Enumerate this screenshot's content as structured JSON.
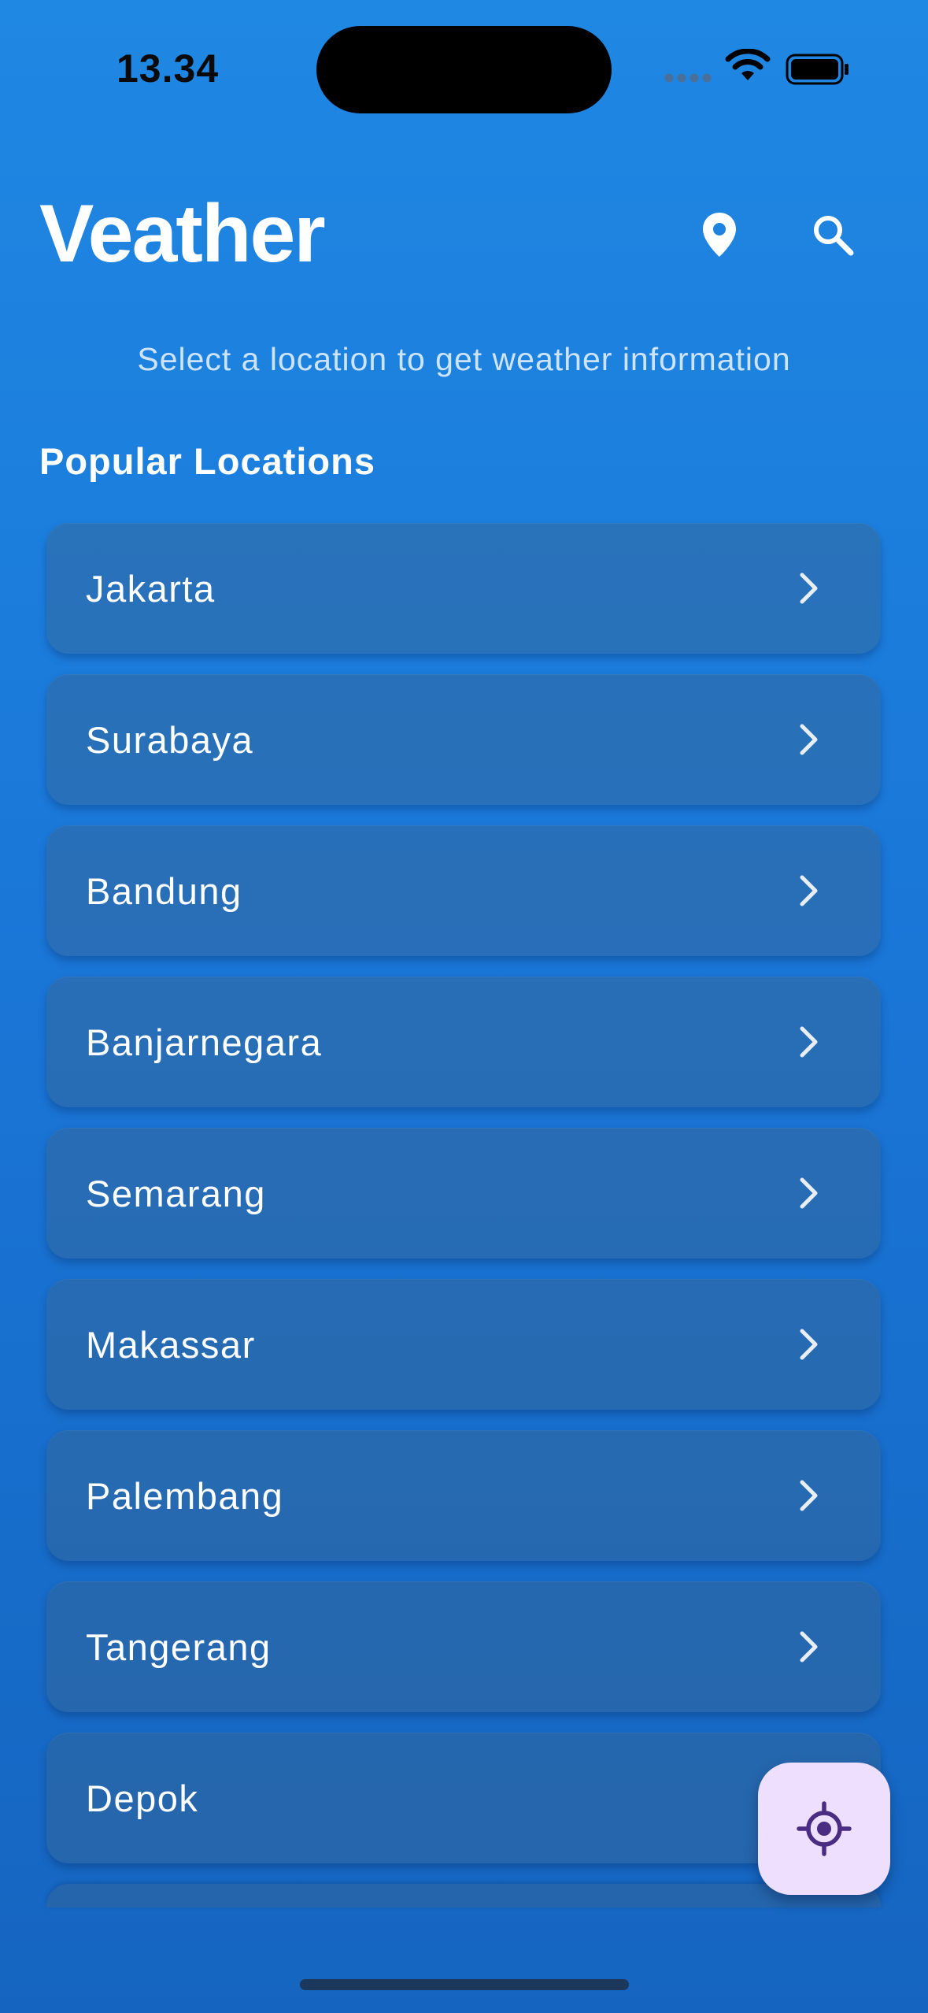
{
  "status_bar": {
    "time": "13.34",
    "icons": [
      "signal-icon",
      "wifi-icon",
      "battery-icon"
    ]
  },
  "header": {
    "title": "Veather",
    "actions": [
      {
        "name": "location-pin-icon"
      },
      {
        "name": "search-icon"
      }
    ]
  },
  "subtitle": "Select a location to get weather information",
  "section": {
    "title": "Popular Locations"
  },
  "locations": [
    {
      "name": "Jakarta"
    },
    {
      "name": "Surabaya"
    },
    {
      "name": "Bandung"
    },
    {
      "name": "Banjarnegara"
    },
    {
      "name": "Semarang"
    },
    {
      "name": "Makassar"
    },
    {
      "name": "Palembang"
    },
    {
      "name": "Tangerang"
    },
    {
      "name": "Depok"
    }
  ],
  "fab": {
    "icon": "my-location-icon"
  },
  "colors": {
    "background_top": "#1f88e3",
    "background_bottom": "#1565c0",
    "fab_background": "#efdffe",
    "fab_icon": "#4a2d82"
  }
}
